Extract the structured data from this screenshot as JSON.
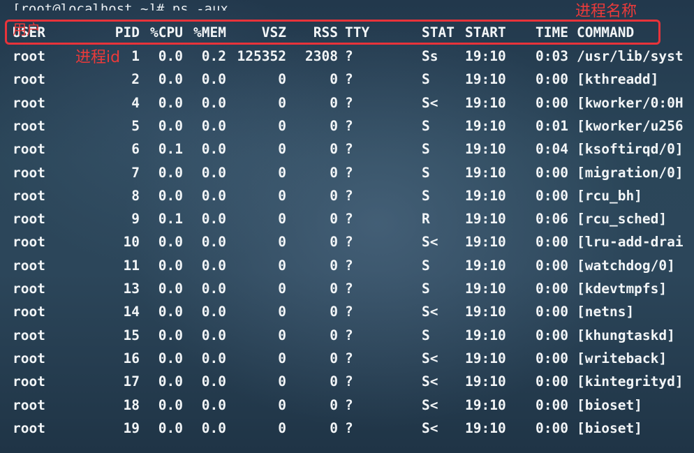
{
  "prompt": "[root@localhost ~]# ps -aux",
  "annotations": {
    "process_name": "进程名称",
    "user": "用户",
    "process_id": "进程id"
  },
  "colors": {
    "annotation": "#e8333a",
    "text": "#f2f5f7"
  },
  "headers": {
    "user": "USER",
    "pid": "PID",
    "cpu": "%CPU",
    "mem": "%MEM",
    "vsz": "VSZ",
    "rss": "RSS",
    "tty": "TTY",
    "stat": "STAT",
    "start": "START",
    "time": "TIME",
    "command": "COMMAND"
  },
  "rows": [
    {
      "user": "root",
      "pid": "1",
      "cpu": "0.0",
      "mem": "0.2",
      "vsz": "125352",
      "rss": "2308",
      "tty": "?",
      "stat": "Ss",
      "start": "19:10",
      "time": "0:03",
      "command": "/usr/lib/syst"
    },
    {
      "user": "root",
      "pid": "2",
      "cpu": "0.0",
      "mem": "0.0",
      "vsz": "0",
      "rss": "0",
      "tty": "?",
      "stat": "S",
      "start": "19:10",
      "time": "0:00",
      "command": "[kthreadd]"
    },
    {
      "user": "root",
      "pid": "4",
      "cpu": "0.0",
      "mem": "0.0",
      "vsz": "0",
      "rss": "0",
      "tty": "?",
      "stat": "S<",
      "start": "19:10",
      "time": "0:00",
      "command": "[kworker/0:0H"
    },
    {
      "user": "root",
      "pid": "5",
      "cpu": "0.0",
      "mem": "0.0",
      "vsz": "0",
      "rss": "0",
      "tty": "?",
      "stat": "S",
      "start": "19:10",
      "time": "0:01",
      "command": "[kworker/u256"
    },
    {
      "user": "root",
      "pid": "6",
      "cpu": "0.1",
      "mem": "0.0",
      "vsz": "0",
      "rss": "0",
      "tty": "?",
      "stat": "S",
      "start": "19:10",
      "time": "0:04",
      "command": "[ksoftirqd/0]"
    },
    {
      "user": "root",
      "pid": "7",
      "cpu": "0.0",
      "mem": "0.0",
      "vsz": "0",
      "rss": "0",
      "tty": "?",
      "stat": "S",
      "start": "19:10",
      "time": "0:00",
      "command": "[migration/0]"
    },
    {
      "user": "root",
      "pid": "8",
      "cpu": "0.0",
      "mem": "0.0",
      "vsz": "0",
      "rss": "0",
      "tty": "?",
      "stat": "S",
      "start": "19:10",
      "time": "0:00",
      "command": "[rcu_bh]"
    },
    {
      "user": "root",
      "pid": "9",
      "cpu": "0.1",
      "mem": "0.0",
      "vsz": "0",
      "rss": "0",
      "tty": "?",
      "stat": "R",
      "start": "19:10",
      "time": "0:06",
      "command": "[rcu_sched]"
    },
    {
      "user": "root",
      "pid": "10",
      "cpu": "0.0",
      "mem": "0.0",
      "vsz": "0",
      "rss": "0",
      "tty": "?",
      "stat": "S<",
      "start": "19:10",
      "time": "0:00",
      "command": "[lru-add-drai"
    },
    {
      "user": "root",
      "pid": "11",
      "cpu": "0.0",
      "mem": "0.0",
      "vsz": "0",
      "rss": "0",
      "tty": "?",
      "stat": "S",
      "start": "19:10",
      "time": "0:00",
      "command": "[watchdog/0]"
    },
    {
      "user": "root",
      "pid": "13",
      "cpu": "0.0",
      "mem": "0.0",
      "vsz": "0",
      "rss": "0",
      "tty": "?",
      "stat": "S",
      "start": "19:10",
      "time": "0:00",
      "command": "[kdevtmpfs]"
    },
    {
      "user": "root",
      "pid": "14",
      "cpu": "0.0",
      "mem": "0.0",
      "vsz": "0",
      "rss": "0",
      "tty": "?",
      "stat": "S<",
      "start": "19:10",
      "time": "0:00",
      "command": "[netns]"
    },
    {
      "user": "root",
      "pid": "15",
      "cpu": "0.0",
      "mem": "0.0",
      "vsz": "0",
      "rss": "0",
      "tty": "?",
      "stat": "S",
      "start": "19:10",
      "time": "0:00",
      "command": "[khungtaskd]"
    },
    {
      "user": "root",
      "pid": "16",
      "cpu": "0.0",
      "mem": "0.0",
      "vsz": "0",
      "rss": "0",
      "tty": "?",
      "stat": "S<",
      "start": "19:10",
      "time": "0:00",
      "command": "[writeback]"
    },
    {
      "user": "root",
      "pid": "17",
      "cpu": "0.0",
      "mem": "0.0",
      "vsz": "0",
      "rss": "0",
      "tty": "?",
      "stat": "S<",
      "start": "19:10",
      "time": "0:00",
      "command": "[kintegrityd]"
    },
    {
      "user": "root",
      "pid": "18",
      "cpu": "0.0",
      "mem": "0.0",
      "vsz": "0",
      "rss": "0",
      "tty": "?",
      "stat": "S<",
      "start": "19:10",
      "time": "0:00",
      "command": "[bioset]"
    },
    {
      "user": "root",
      "pid": "19",
      "cpu": "0.0",
      "mem": "0.0",
      "vsz": "0",
      "rss": "0",
      "tty": "?",
      "stat": "S<",
      "start": "19:10",
      "time": "0:00",
      "command": "[bioset]"
    }
  ]
}
